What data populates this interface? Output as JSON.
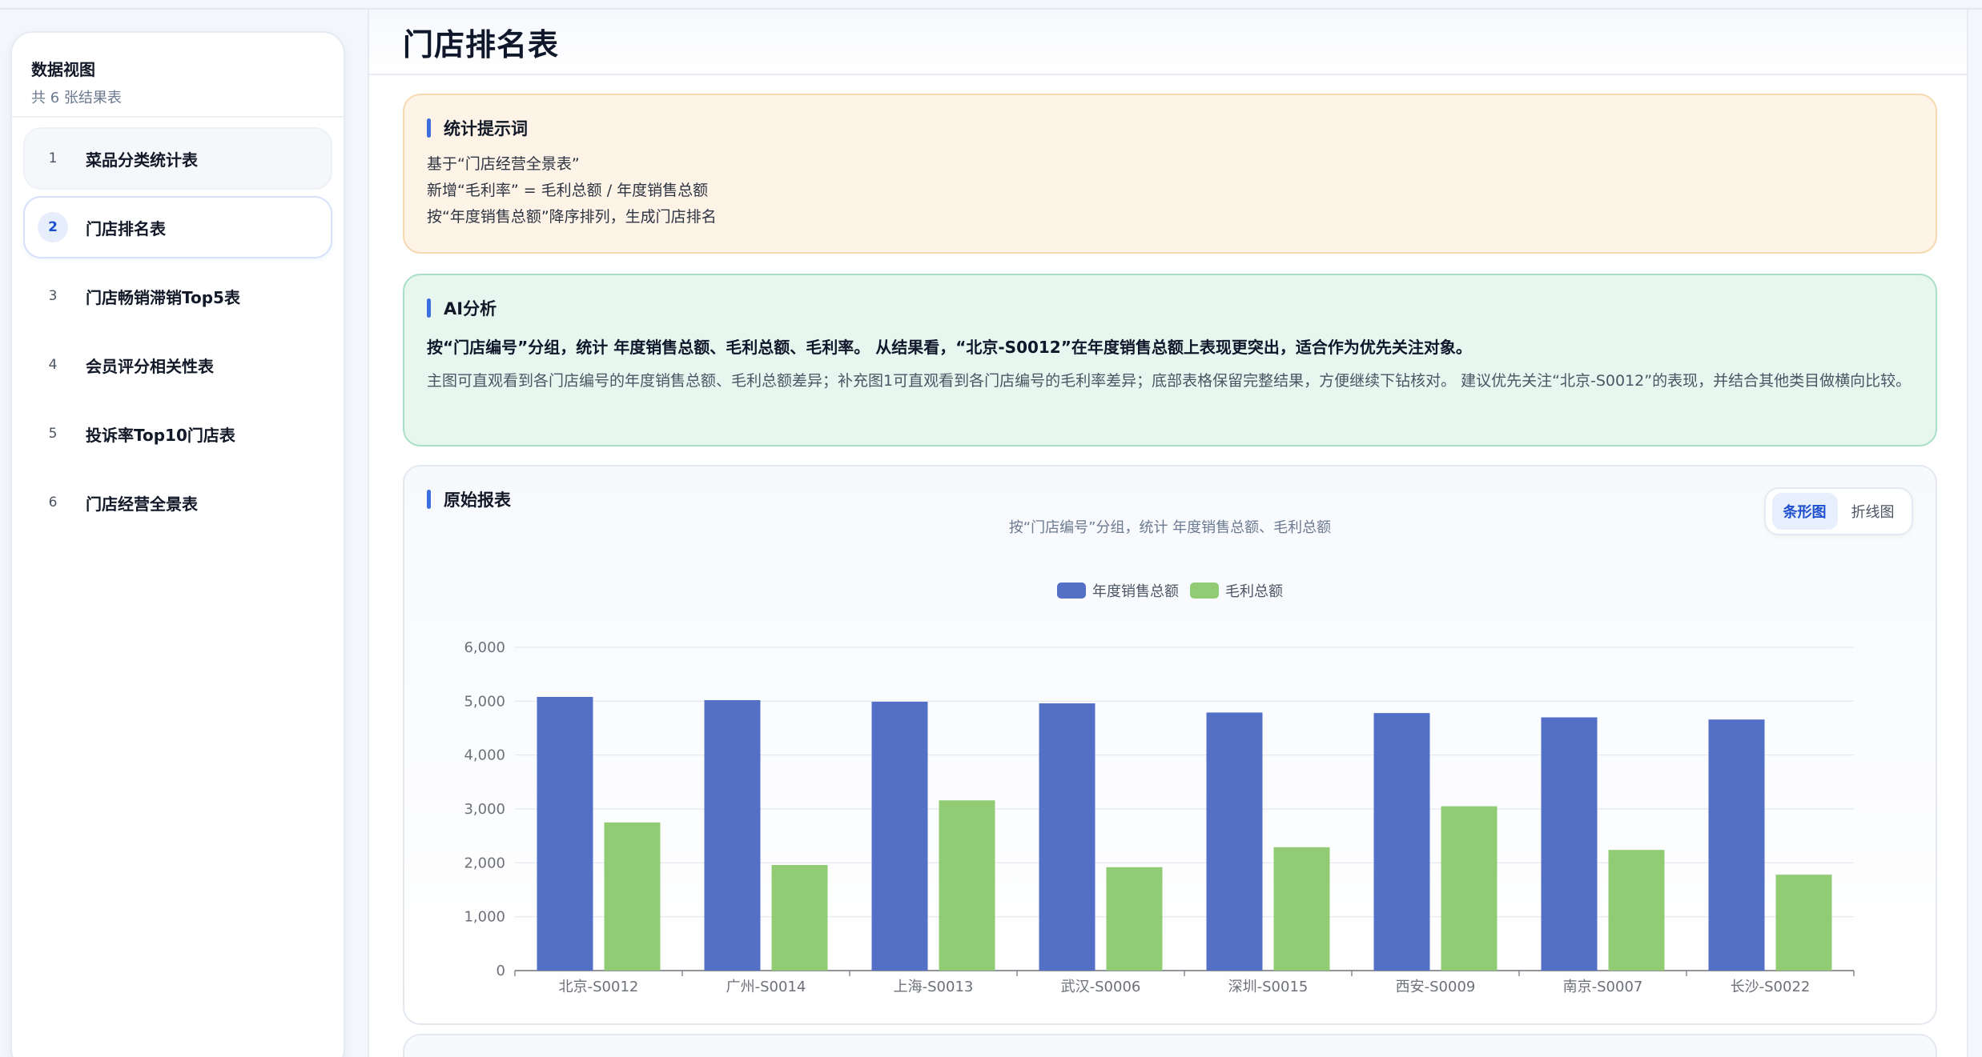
{
  "sidebar": {
    "title": "数据视图",
    "subtitle": "共 6 张结果表",
    "items": [
      {
        "num": "1",
        "label": "菜品分类统计表"
      },
      {
        "num": "2",
        "label": "门店排名表"
      },
      {
        "num": "3",
        "label": "门店畅销滞销Top5表"
      },
      {
        "num": "4",
        "label": "会员评分相关性表"
      },
      {
        "num": "5",
        "label": "投诉率Top10门店表"
      },
      {
        "num": "6",
        "label": "门店经营全景表"
      }
    ]
  },
  "main": {
    "title": "门店排名表"
  },
  "prompt": {
    "title": "统计提示词",
    "lines": [
      "基于“门店经营全景表”",
      "新增“毛利率” = 毛利总额 / 年度销售总额",
      "按“年度销售总额”降序排列，生成门店排名"
    ]
  },
  "ai": {
    "title": "AI分析",
    "headline": "按“门店编号”分组，统计 年度销售总额、毛利总额、毛利率。 从结果看，“北京-S0012”在年度销售总额上表现更突出，适合作为优先关注对象。",
    "body": "主图可直观看到各门店编号的年度销售总额、毛利总额差异；补充图1可直观看到各门店编号的毛利率差异；底部表格保留完整结果，方便继续下钻核对。 建议优先关注“北京-S0012”的表现，并结合其他类目做横向比较。"
  },
  "report": {
    "title": "原始报表",
    "switch": {
      "bar": "条形图",
      "line": "折线图"
    }
  },
  "colors": {
    "series1": "#5470c6",
    "series2": "#91cc75",
    "accent": "#3b6fe0"
  },
  "chart_data": {
    "type": "bar",
    "title": "按“门店编号”分组，统计 年度销售总额、毛利总额",
    "xlabel": "",
    "ylabel": "",
    "categories": [
      "北京-S0012",
      "广州-S0014",
      "上海-S0013",
      "武汉-S0006",
      "深圳-S0015",
      "西安-S0009",
      "南京-S0007",
      "长沙-S0022"
    ],
    "series": [
      {
        "name": "年度销售总额",
        "values": [
          5080,
          5020,
          4990,
          4960,
          4790,
          4780,
          4700,
          4660
        ]
      },
      {
        "name": "毛利总额",
        "values": [
          2750,
          1960,
          3160,
          1920,
          2290,
          3050,
          2240,
          1780
        ]
      }
    ],
    "ylim": [
      0,
      6000
    ],
    "yticks": [
      "0",
      "1,000",
      "2,000",
      "3,000",
      "4,000",
      "5,000",
      "6,000"
    ],
    "grid": true,
    "legend": "top-center"
  }
}
